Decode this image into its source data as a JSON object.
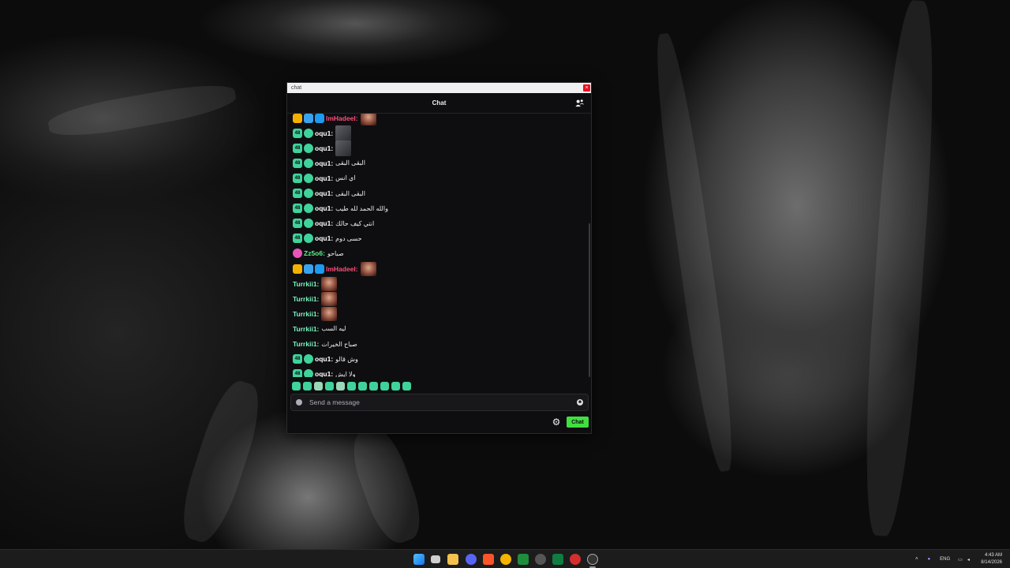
{
  "window": {
    "titlebar_label": "chat",
    "close_glyph": "×",
    "header_title": "Chat",
    "users_icon": "users-icon"
  },
  "messages": [
    {
      "user": "ImHadeel",
      "badges": [
        "crown",
        "mod",
        "prime"
      ],
      "text": "",
      "emote": "face-emote"
    },
    {
      "user": "oqu1",
      "badges": [
        "sub",
        "verified"
      ],
      "text": "",
      "emote": "gray-emote"
    },
    {
      "user": "oqu1",
      "badges": [
        "sub",
        "verified"
      ],
      "text": "",
      "emote": "gray-emote"
    },
    {
      "user": "oqu1",
      "badges": [
        "sub",
        "verified"
      ],
      "text": "البقى البقى"
    },
    {
      "user": "oqu1",
      "badges": [
        "sub",
        "verified"
      ],
      "text": "اي انس"
    },
    {
      "user": "oqu1",
      "badges": [
        "sub",
        "verified"
      ],
      "text": "البقى البقى"
    },
    {
      "user": "oqu1",
      "badges": [
        "sub",
        "verified"
      ],
      "text": "والله الحمد لله طيب"
    },
    {
      "user": "oqu1",
      "badges": [
        "sub",
        "verified"
      ],
      "text": "انتي كيف حالك"
    },
    {
      "user": "oqu1",
      "badges": [
        "sub",
        "verified"
      ],
      "text": "حسى دوم"
    },
    {
      "user": "Zz5o6",
      "badges": [
        "pink"
      ],
      "text": "صباحو"
    },
    {
      "user": "ImHadeel",
      "badges": [
        "crown",
        "mod",
        "prime"
      ],
      "text": "",
      "emote": "face-emote"
    },
    {
      "user": "Turrkii1",
      "badges": [],
      "text": "",
      "emote": "face-emote"
    },
    {
      "user": "Turrkii1",
      "badges": [],
      "text": "",
      "emote": "face-emote"
    },
    {
      "user": "Turrkii1",
      "badges": [],
      "text": "",
      "emote": "face-emote"
    },
    {
      "user": "Turrkii1",
      "badges": [],
      "text": "ليه السب"
    },
    {
      "user": "Turrkii1",
      "badges": [],
      "text": "صباح الخيرات"
    },
    {
      "user": "oqu1",
      "badges": [
        "sub",
        "verified"
      ],
      "text": "وش قالو"
    },
    {
      "user": "oqu1",
      "badges": [
        "sub",
        "verified"
      ],
      "text": "ولا ايش"
    }
  ],
  "badge_labels": {
    "sub": "48"
  },
  "input": {
    "placeholder": "Send a message"
  },
  "buttons": {
    "chat_label": "Chat",
    "settings_glyph": "⚙"
  },
  "taskbar": {
    "lang": "ENG",
    "time": "4:43 AM",
    "date": "8/14/2026"
  },
  "colors": {
    "accent_green": "#3fe03f",
    "sub_badge": "#3fd39b",
    "imhadeel_name": "#ff4d7d",
    "zz_name": "#5cf08a"
  }
}
